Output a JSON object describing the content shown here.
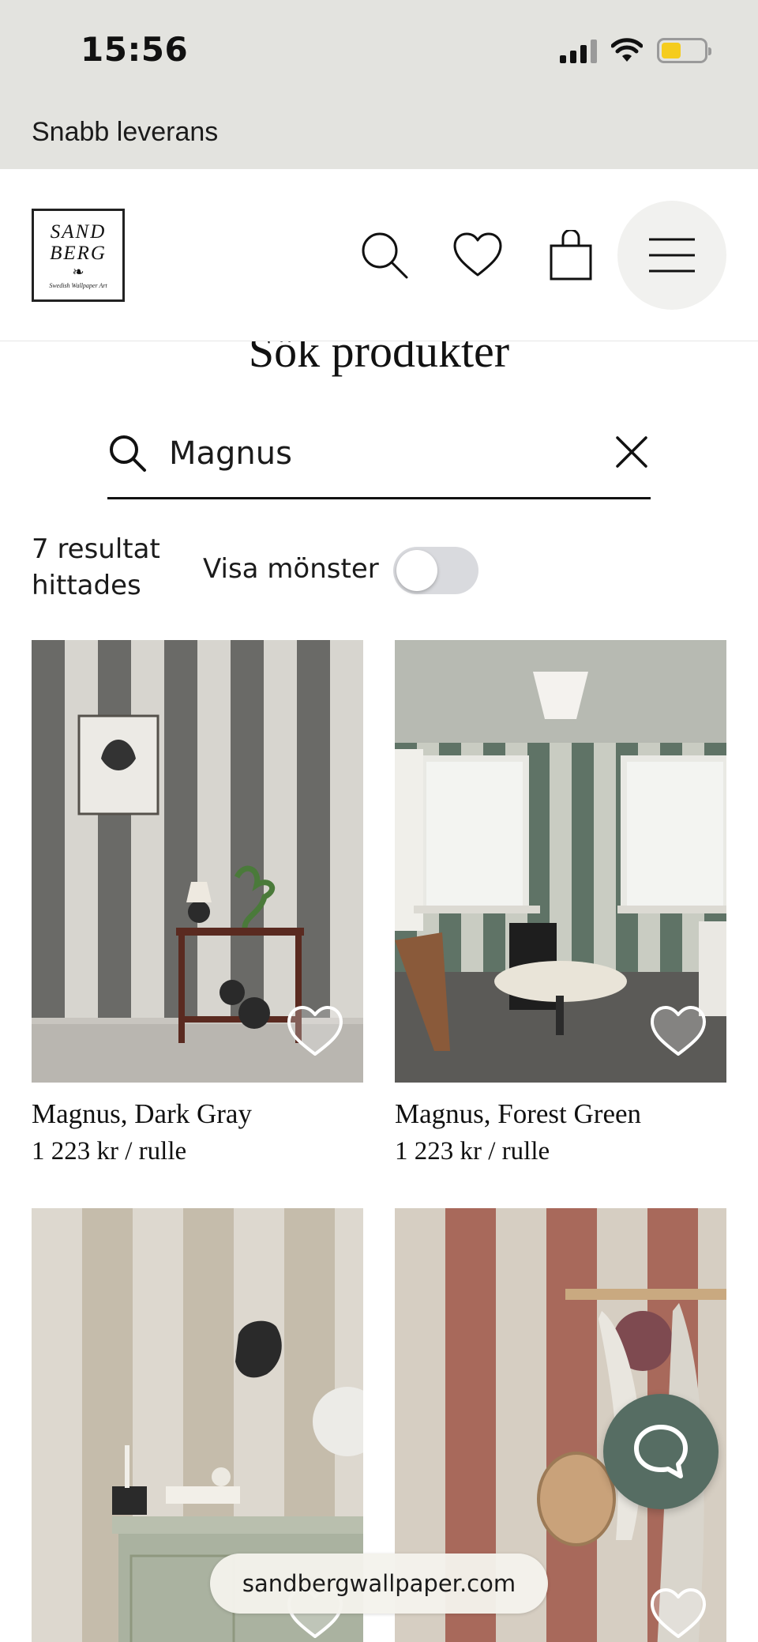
{
  "status_bar": {
    "time": "15:56"
  },
  "promo": {
    "text": "Snabb leverans"
  },
  "brand": {
    "line1": "SAND",
    "line2": "BERG",
    "tagline": "Swedish Wallpaper Art"
  },
  "search": {
    "title": "Sök produkter",
    "query": "Magnus"
  },
  "results": {
    "count_text": "7 resultat hittades",
    "toggle_label": "Visa mönster",
    "toggle_on": false
  },
  "products": [
    {
      "name": "Magnus, Dark Gray",
      "price": "1 223 kr / rulle"
    },
    {
      "name": "Magnus, Forest Green",
      "price": "1 223 kr / rulle"
    },
    {
      "name": "",
      "price": ""
    },
    {
      "name": "",
      "price": ""
    }
  ],
  "browser": {
    "url": "sandbergwallpaper.com"
  },
  "colors": {
    "accent": "#566d63",
    "header_bg": "#e3e3df",
    "toggle_off": "#d9dade"
  }
}
